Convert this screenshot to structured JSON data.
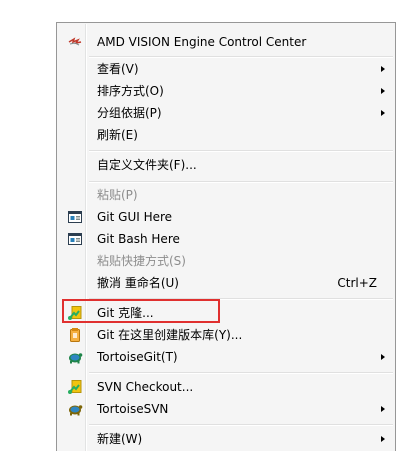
{
  "menu": {
    "items": [
      {
        "label": "AMD VISION Engine Control Center",
        "icon": "amd-icon"
      },
      {
        "label": "查看(V)",
        "submenu": true
      },
      {
        "label": "排序方式(O)",
        "submenu": true
      },
      {
        "label": "分组依据(P)",
        "submenu": true
      },
      {
        "label": "刷新(E)"
      },
      {
        "label": "自定义文件夹(F)..."
      },
      {
        "label": "粘贴(P)",
        "disabled": true
      },
      {
        "label": "Git GUI Here",
        "icon": "git-gui-icon"
      },
      {
        "label": "Git Bash Here",
        "icon": "git-bash-icon"
      },
      {
        "label": "粘贴快捷方式(S)",
        "disabled": true
      },
      {
        "label": "撤消 重命名(U)",
        "shortcut": "Ctrl+Z"
      },
      {
        "label": "Git 克隆...",
        "icon": "tortoisegit-clone-icon"
      },
      {
        "label": "Git 在这里创建版本库(Y)...",
        "icon": "tortoisegit-create-repo-icon"
      },
      {
        "label": "TortoiseGit(T)",
        "icon": "tortoisegit-icon",
        "submenu": true
      },
      {
        "label": "SVN Checkout...",
        "icon": "svn-checkout-icon"
      },
      {
        "label": "TortoiseSVN",
        "icon": "tortoisesvn-icon",
        "submenu": true
      },
      {
        "label": "新建(W)",
        "submenu": true
      }
    ]
  },
  "colors": {
    "highlight_border": "#e0302f",
    "disabled_text": "#8d8d8d",
    "menu_background": "#f5f5f5"
  }
}
